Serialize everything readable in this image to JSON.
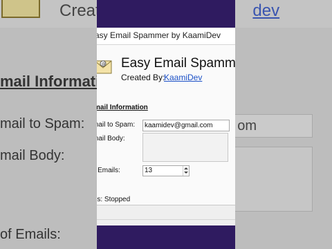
{
  "background": {
    "heading": "Create",
    "link": "dev",
    "section": "mail Informatio",
    "label_email": "mail to Spam:",
    "email_value": "om",
    "label_body": "mail Body:",
    "label_num": "of Emails:"
  },
  "window": {
    "title": "asy Email Spammer by KaamiDev",
    "app_title": "Easy Email Spammer",
    "created_by_label": "Created By:",
    "author": "KaamiDev",
    "section_title": "mail Information",
    "email_label": "mail to Spam:",
    "email_value": "kaamidev@gmail.com",
    "body_label": "mail Body:",
    "body_value": "",
    "num_label": "of Emails:",
    "num_value": "13",
    "status": "tus: Stopped"
  },
  "icons": [
    "envelope-icon",
    "spin-up-icon",
    "spin-down-icon"
  ],
  "colors": {
    "backdrop": "#2f1b60",
    "link": "#1a4fc6"
  }
}
